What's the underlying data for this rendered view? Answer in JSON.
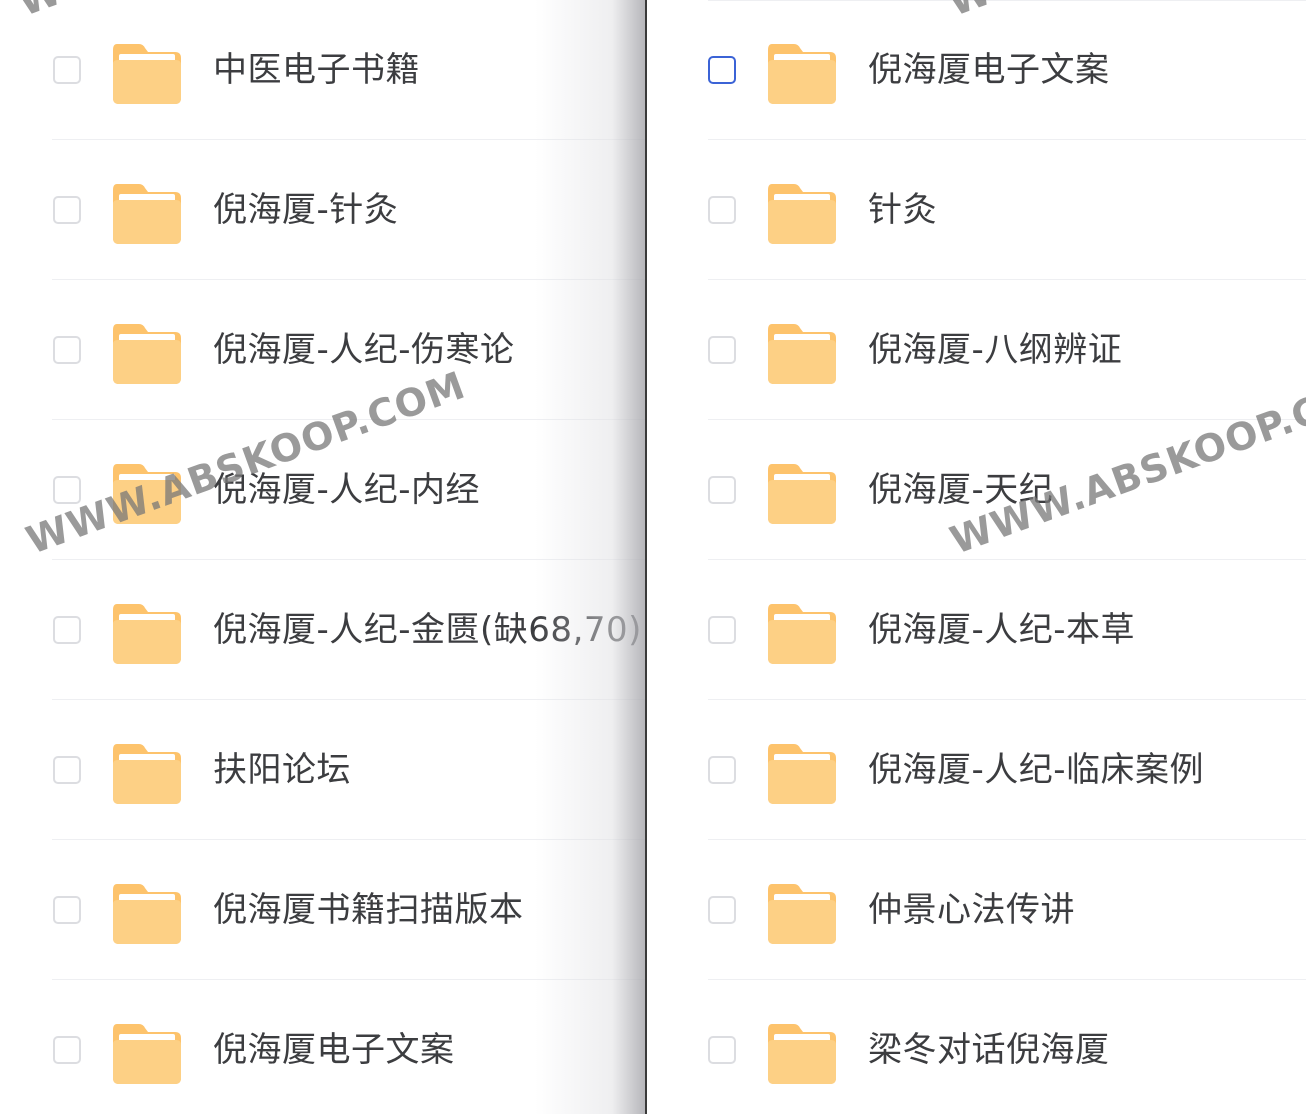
{
  "left_list": {
    "items": [
      {
        "label": "中医电子书籍",
        "checked": false
      },
      {
        "label": "倪海厦-针灸",
        "checked": false
      },
      {
        "label": "倪海厦-人纪-伤寒论",
        "checked": false
      },
      {
        "label": "倪海厦-人纪-内经",
        "checked": false
      },
      {
        "label": "倪海厦-人纪-金匮(缺68,70)",
        "checked": false
      },
      {
        "label": "扶阳论坛",
        "checked": false
      },
      {
        "label": "倪海厦书籍扫描版本",
        "checked": false
      },
      {
        "label": "倪海厦电子文案",
        "checked": false
      }
    ]
  },
  "right_list": {
    "items": [
      {
        "label": "倪海厦电子文案",
        "checked": false
      },
      {
        "label": "针灸",
        "checked": false
      },
      {
        "label": "倪海厦-八纲辨证",
        "checked": false
      },
      {
        "label": "倪海厦-天纪",
        "checked": false
      },
      {
        "label": "倪海厦-人纪-本草",
        "checked": false
      },
      {
        "label": "倪海厦-人纪-临床案例",
        "checked": false
      },
      {
        "label": "仲景心法传讲",
        "checked": false
      },
      {
        "label": "梁冬对话倪海厦",
        "checked": false
      }
    ]
  },
  "watermark": {
    "text": "WWW.ABSKOOP.COM",
    "top_fragment": "WW"
  },
  "colors": {
    "folder_body": "#fdd085",
    "folder_tab": "#fdc36c",
    "folder_paper": "#ffffff",
    "checkbox_border": "#dcdde1",
    "checkbox_focus": "#3b63d6",
    "text": "#3c3d40"
  },
  "icons": {
    "folder": "folder-icon",
    "checkbox": "checkbox"
  }
}
